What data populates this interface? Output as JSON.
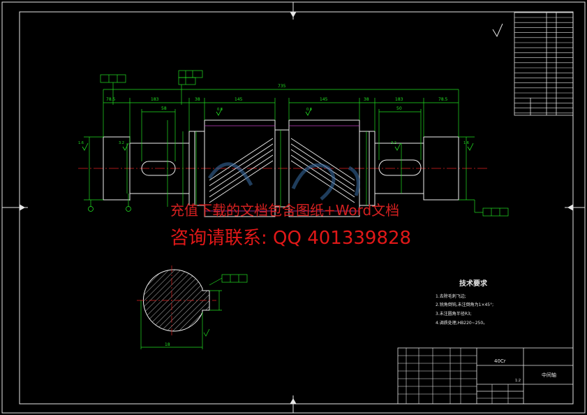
{
  "dims": {
    "overall": "735",
    "d1": "78.5",
    "d2": "183",
    "d3": "38",
    "d4": "145",
    "d5": "145",
    "d6": "38",
    "d7": "183",
    "d8": "78.5",
    "d9": "58",
    "d10": "50"
  },
  "roughness": [
    "0.8",
    "0.8",
    "3.2",
    "3.2",
    "1.6",
    "1.6"
  ],
  "section_label": "18",
  "notes": {
    "title": "技术要求",
    "items": [
      "1.去除毛刺飞边;",
      "2.锐角倒钝,未注倒角为1×45°;",
      "3.未注圆角半径R3;",
      "4.调质处理,HB220~250。"
    ]
  },
  "title_block": {
    "material": "40Cr",
    "part_name": "中间轴",
    "ratio": "1:2"
  },
  "watermark": {
    "line1": "充值下载的文档包含图纸+Word文档",
    "line2": "咨询请联系: QQ 401339828"
  }
}
